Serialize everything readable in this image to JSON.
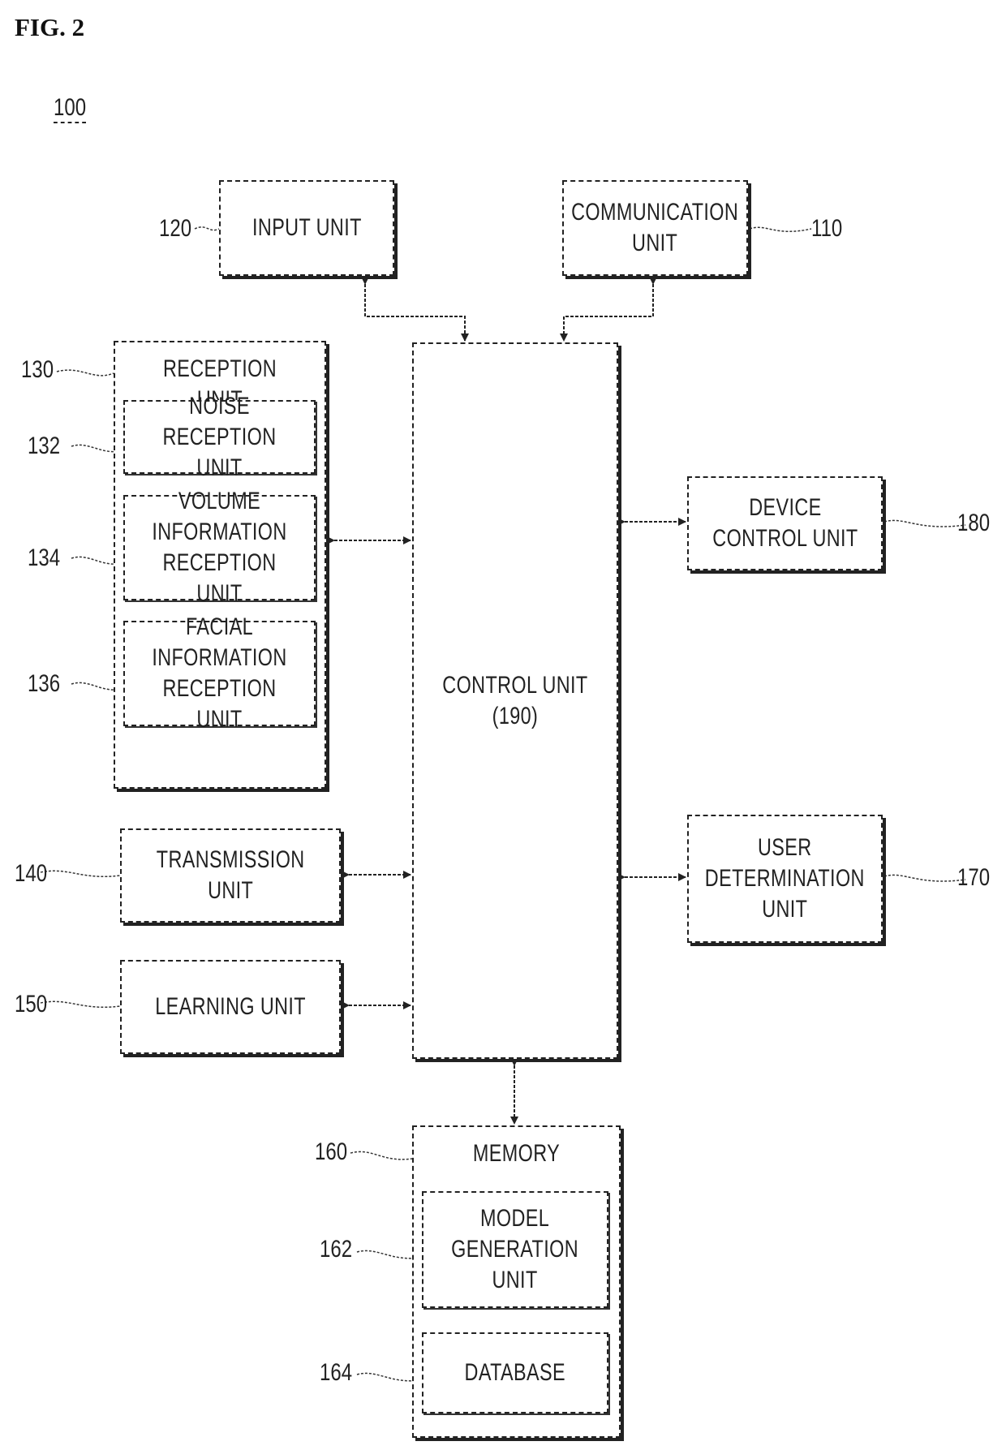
{
  "figure": {
    "title": "FIG. 2",
    "system_ref": "100"
  },
  "blocks": {
    "input_unit": {
      "label": "INPUT UNIT",
      "ref": "120"
    },
    "communication_unit": {
      "label": "COMMUNICATION\nUNIT",
      "ref": "110"
    },
    "reception_unit": {
      "label": "RECEPTION UNIT",
      "ref": "130"
    },
    "noise_reception_unit": {
      "label": "NOISE\nRECEPTION UNIT",
      "ref": "132"
    },
    "volume_information_reception_unit": {
      "label": "VOLUME\nINFORMATION\nRECEPTION UNIT",
      "ref": "134"
    },
    "facial_information_reception_unit": {
      "label": "FACIAL\nINFORMATION\nRECEPTION UNIT",
      "ref": "136"
    },
    "transmission_unit": {
      "label": "TRANSMISSION\nUNIT",
      "ref": "140"
    },
    "learning_unit": {
      "label": "LEARNING UNIT",
      "ref": "150"
    },
    "control_unit": {
      "label": "CONTROL UNIT\n(190)"
    },
    "device_control_unit": {
      "label": "DEVICE\nCONTROL UNIT",
      "ref": "180"
    },
    "user_determination_unit": {
      "label": "USER\nDETERMINATION\nUNIT",
      "ref": "170"
    },
    "memory": {
      "label": "MEMORY",
      "ref": "160"
    },
    "model_generation_unit": {
      "label": "MODEL\nGENERATION\nUNIT",
      "ref": "162"
    },
    "database": {
      "label": "DATABASE",
      "ref": "164"
    }
  },
  "connections": [
    {
      "from": "input_unit",
      "to": "control_unit",
      "type": "bidirectional"
    },
    {
      "from": "communication_unit",
      "to": "control_unit",
      "type": "bidirectional"
    },
    {
      "from": "reception_unit",
      "to": "control_unit",
      "type": "bidirectional"
    },
    {
      "from": "transmission_unit",
      "to": "control_unit",
      "type": "bidirectional"
    },
    {
      "from": "learning_unit",
      "to": "control_unit",
      "type": "bidirectional"
    },
    {
      "from": "control_unit",
      "to": "device_control_unit",
      "type": "bidirectional"
    },
    {
      "from": "control_unit",
      "to": "user_determination_unit",
      "type": "bidirectional"
    },
    {
      "from": "control_unit",
      "to": "memory",
      "type": "bidirectional"
    }
  ]
}
